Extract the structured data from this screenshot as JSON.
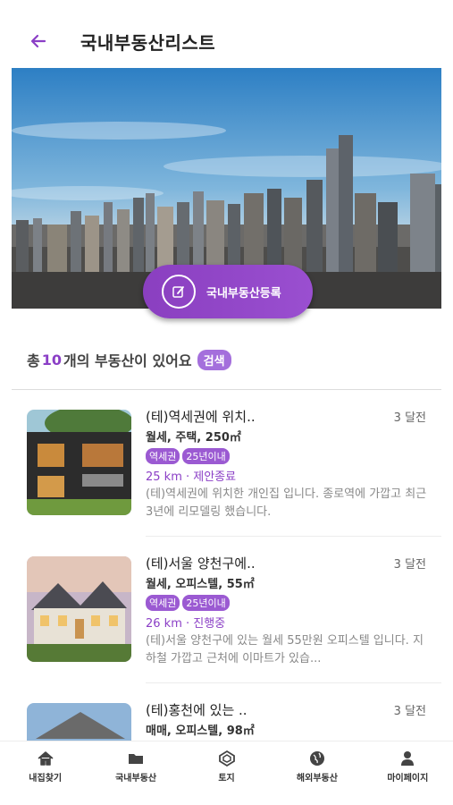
{
  "header": {
    "title": "국내부동산리스트",
    "back_icon": "arrow-left-icon"
  },
  "hero": {
    "register_label": "국내부동산등록",
    "register_icon": "edit-icon"
  },
  "summary": {
    "prefix": "총",
    "count": "10",
    "suffix": "개의 부동산이 있어요",
    "search_label": "검색"
  },
  "listings": [
    {
      "title": "(테)역세권에 위치..",
      "time": "3 달전",
      "meta": "월세, 주택, 250㎡",
      "tags": [
        "역세권",
        "25년이내"
      ],
      "status": "25 km · 제안종료",
      "desc": "(테)역세권에 위치한 개인집 입니다. 종로역에 가깝고 최근 3년에 리모델링 했습니다."
    },
    {
      "title": "(테)서울 양천구에..",
      "time": "3 달전",
      "meta": "월세, 오피스텔, 55㎡",
      "tags": [
        "역세권",
        "25년이내"
      ],
      "status": "26 km · 진행중",
      "desc": "(테)서울 양천구에 있는 월세 55만원 오피스텔 입니다. 지하철 가깝고 근처에 이마트가 있습..."
    },
    {
      "title": "(테)홍천에 있는 ..",
      "time": "3 달전",
      "meta": "매매, 오피스텔, 98㎡",
      "tags": [],
      "status": "",
      "desc": ""
    }
  ],
  "nav": [
    {
      "label": "내집찾기",
      "icon": "home-icon"
    },
    {
      "label": "국내부동산",
      "icon": "folder-icon"
    },
    {
      "label": "토지",
      "icon": "land-icon"
    },
    {
      "label": "해외부동산",
      "icon": "globe-icon"
    },
    {
      "label": "마이페이지",
      "icon": "user-icon"
    }
  ],
  "colors": {
    "accent": "#8b3fc6",
    "chip": "#a46fdc",
    "tag": "#9b5ad2"
  }
}
